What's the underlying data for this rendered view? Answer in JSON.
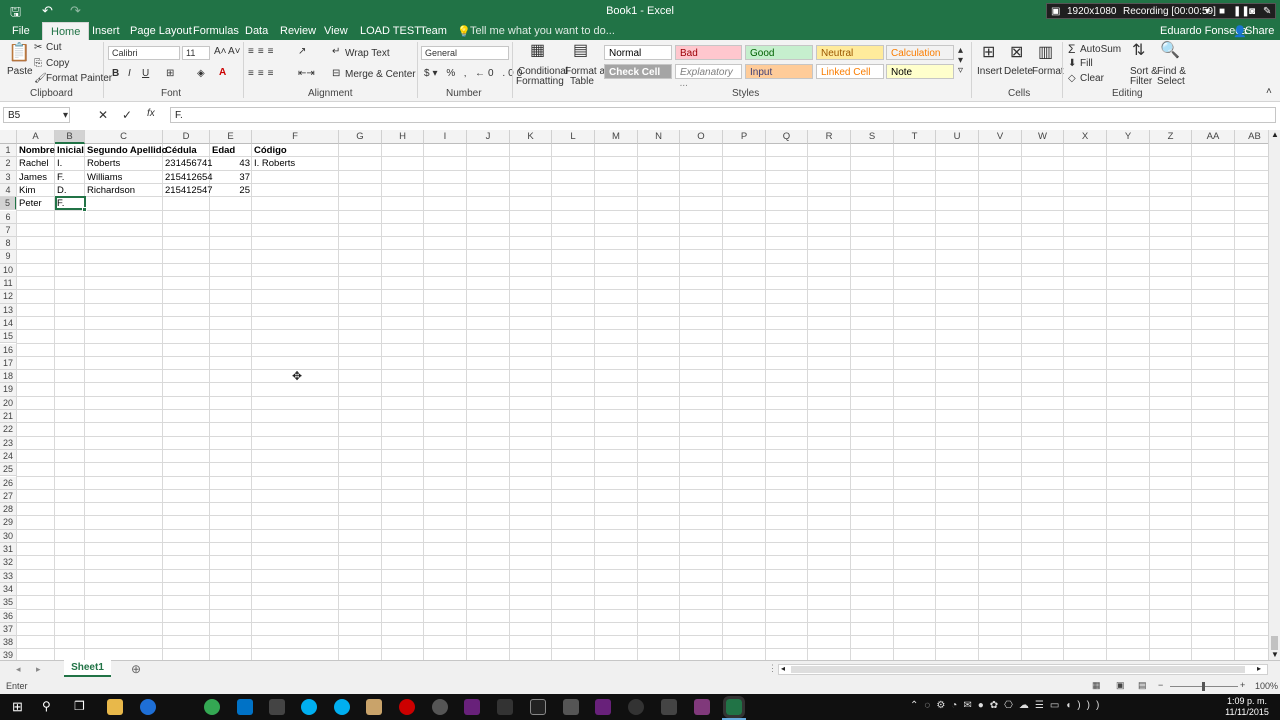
{
  "window": {
    "title": "Book1 - Excel",
    "user": "Eduardo Fonseca",
    "share": "Share",
    "recording_res": "1920x1080",
    "recording_time": "Recording [00:00:59]"
  },
  "tabs": [
    "File",
    "Home",
    "Insert",
    "Page Layout",
    "Formulas",
    "Data",
    "Review",
    "View",
    "LOAD TEST",
    "Team"
  ],
  "tell_me": "Tell me what you want to do...",
  "ribbon": {
    "clipboard": {
      "paste": "Paste",
      "cut": "Cut",
      "copy": "Copy",
      "format_painter": "Format Painter",
      "label": "Clipboard"
    },
    "font": {
      "name": "Calibri",
      "size": "11",
      "bold": "B",
      "italic": "I",
      "underline": "U",
      "label": "Font"
    },
    "alignment": {
      "wrap": "Wrap Text",
      "merge": "Merge & Center",
      "label": "Alignment"
    },
    "number": {
      "format": "General",
      "label": "Number"
    },
    "styles": {
      "cond1": "Conditional",
      "cond2": "Formatting",
      "fmt1": "Format as",
      "fmt2": "Table",
      "label": "Styles",
      "cells": [
        "Normal",
        "Bad",
        "Good",
        "Neutral",
        "Calculation",
        "Check Cell",
        "Explanatory ...",
        "Input",
        "Linked Cell",
        "Note"
      ]
    },
    "cells": {
      "insert": "Insert",
      "delete": "Delete",
      "format": "Format",
      "label": "Cells"
    },
    "editing": {
      "autosum": "AutoSum",
      "fill": "Fill",
      "clear": "Clear",
      "sort1": "Sort &",
      "sort2": "Filter",
      "find1": "Find &",
      "find2": "Select",
      "label": "Editing"
    }
  },
  "formula_bar": {
    "name_box": "B5",
    "formula": "F."
  },
  "columns": [
    "A",
    "B",
    "C",
    "D",
    "E",
    "F",
    "G",
    "H",
    "I",
    "J",
    "K",
    "L",
    "M",
    "N",
    "O",
    "P",
    "Q",
    "R",
    "S",
    "T",
    "U",
    "V",
    "W",
    "X",
    "Y",
    "Z",
    "AA",
    "AB"
  ],
  "rows": [
    "1",
    "2",
    "3",
    "4",
    "5",
    "6",
    "7",
    "8",
    "9",
    "10",
    "11",
    "12",
    "13",
    "14",
    "15",
    "16",
    "17",
    "18",
    "19",
    "20",
    "21",
    "22",
    "23",
    "24",
    "25",
    "26",
    "27",
    "28",
    "29",
    "30",
    "31",
    "32",
    "33",
    "34",
    "35",
    "36",
    "37",
    "38",
    "39"
  ],
  "headers": [
    "Nombre",
    "Inicial",
    "Segundo Apellido",
    "Cédula",
    "Edad",
    "Código"
  ],
  "data": [
    [
      "Rachel",
      "I.",
      "Roberts",
      "231456741",
      "43",
      "I. Roberts"
    ],
    [
      "James",
      "F.",
      "Williams",
      "215412654",
      "37",
      ""
    ],
    [
      "Kim",
      "D.",
      "Richardson",
      "215412547",
      "25",
      ""
    ],
    [
      "Peter",
      "F.",
      "",
      "",
      "",
      ""
    ]
  ],
  "sheet_tab": "Sheet1",
  "status": {
    "mode": "Enter",
    "zoom": "100%"
  },
  "clock": {
    "time": "1:09 p. m.",
    "date": "11/11/2015"
  },
  "colors": {
    "accent": "#217346",
    "selection": "#217346",
    "taskbar": "#101010"
  }
}
